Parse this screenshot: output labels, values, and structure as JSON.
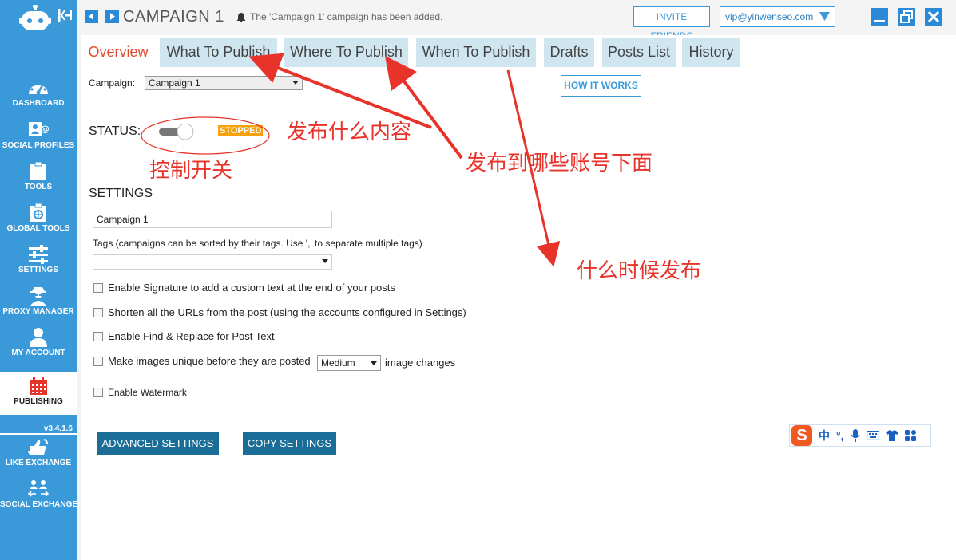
{
  "sidebar": {
    "items": [
      {
        "label": "DASHBOARD",
        "icon": "dashboard-icon"
      },
      {
        "label": "SOCIAL PROFILES",
        "icon": "social-profiles-icon"
      },
      {
        "label": "TOOLS",
        "icon": "tools-icon"
      },
      {
        "label": "GLOBAL TOOLS",
        "icon": "global-tools-icon"
      },
      {
        "label": "SETTINGS",
        "icon": "settings-sliders-icon"
      },
      {
        "label": "PROXY MANAGER",
        "icon": "proxy-agent-icon"
      },
      {
        "label": "MY ACCOUNT",
        "icon": "user-icon"
      },
      {
        "label": "PUBLISHING",
        "icon": "calendar-icon",
        "active": true
      },
      {
        "label": "LIKE EXCHANGE",
        "icon": "like-exchange-icon"
      },
      {
        "label": "SOCIAL EXCHANGE",
        "icon": "social-exchange-icon"
      }
    ],
    "version": "v3.4.1.6"
  },
  "header": {
    "title": "CAMPAIGN 1",
    "notification": "The 'Campaign 1' campaign has been added.",
    "invite_label": "INVITE FRIENDS",
    "account_email": "vip@yinwenseo.com"
  },
  "tabs": [
    {
      "label": "Overview",
      "active": true
    },
    {
      "label": "What To Publish"
    },
    {
      "label": "Where To Publish"
    },
    {
      "label": "When To Publish"
    },
    {
      "label": "Drafts"
    },
    {
      "label": "Posts List"
    },
    {
      "label": "History"
    }
  ],
  "overview": {
    "campaign_label": "Campaign:",
    "campaign_selected": "Campaign 1",
    "how_it_works": "HOW IT WORKS",
    "status_label": "STATUS:",
    "status_value": "STOPPED",
    "settings_title": "SETTINGS",
    "name_value": "Campaign 1",
    "tags_label": "Tags (campaigns can be sorted by their tags. Use ',' to separate multiple tags)",
    "tags_value": "",
    "options": [
      {
        "label": "Enable Signature to add a custom text at the end of your posts",
        "checked": false
      },
      {
        "label": "Shorten all the URLs from the post (using the accounts configured in Settings)",
        "checked": false
      },
      {
        "label": "Enable Find & Replace for Post Text",
        "checked": false
      },
      {
        "label": "Make images unique before they are posted",
        "checked": false
      },
      {
        "label": "Enable Watermark",
        "checked": false
      }
    ],
    "image_level": "Medium",
    "image_changes_suffix": "image changes",
    "advanced_settings": "ADVANCED SETTINGS",
    "copy_settings": "COPY SETTINGS"
  },
  "ime_toolbar": {
    "logo": "S",
    "mode": "中",
    "punct": "°,"
  },
  "annotations": {
    "switch": "控制开关",
    "what": "发布什么内容",
    "where": "发布到哪些账号下面",
    "when": "什么时候发布"
  },
  "colors": {
    "sidebar": "#3a9ad9",
    "accent_tab": "#e0492c",
    "tab_bg": "#cfe5ef",
    "button": "#1a6d96",
    "stopped": "#f5a20d",
    "annotation": "#e8332a"
  }
}
